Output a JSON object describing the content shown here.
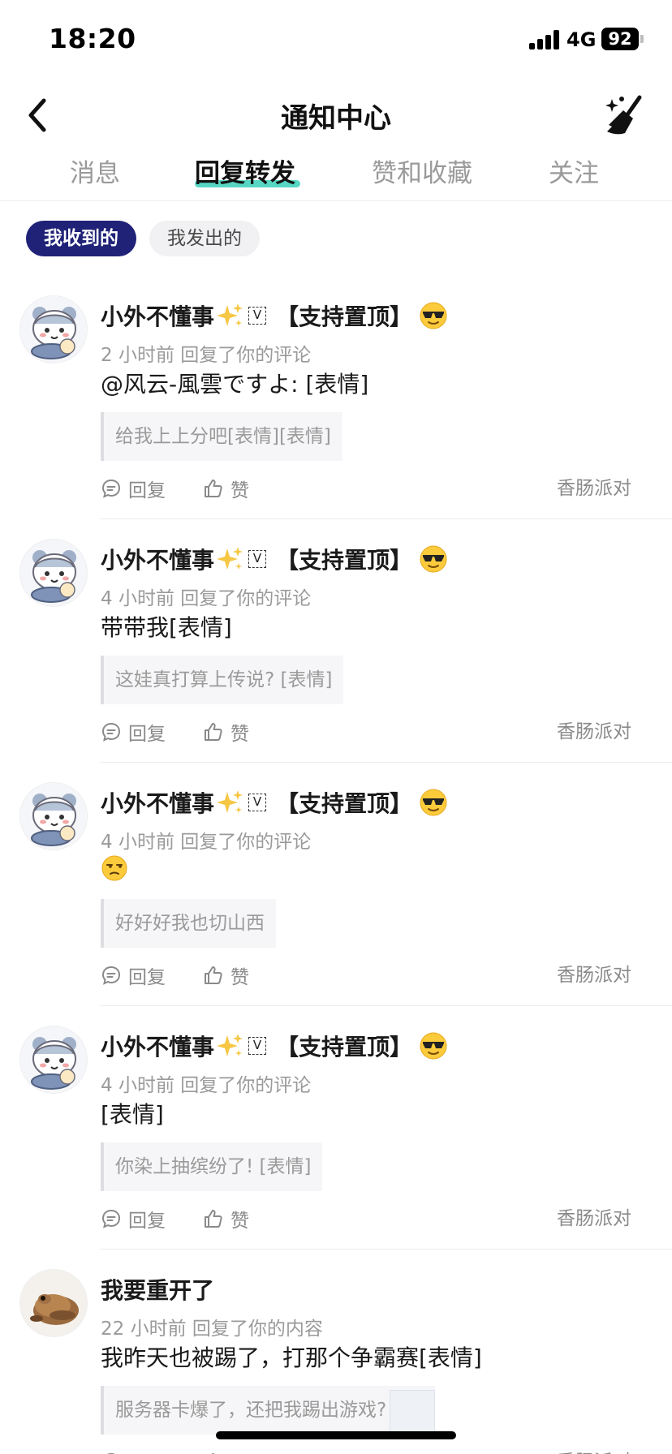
{
  "status_bar": {
    "time": "18:20",
    "network": "4G",
    "battery": "92"
  },
  "nav": {
    "title": "通知中心",
    "back_icon": "chevron-left-icon",
    "clear_icon": "broom-sparkle-icon"
  },
  "tabs": [
    {
      "label": "消息",
      "active": false
    },
    {
      "label": "回复转发",
      "active": true
    },
    {
      "label": "赞和收藏",
      "active": false
    },
    {
      "label": "关注",
      "active": false
    }
  ],
  "filters": {
    "received": "我收到的",
    "sent": "我发出的",
    "active": "received"
  },
  "colors": {
    "accent_navy": "#1f2277",
    "tab_underline": "#58d6c4",
    "muted_text": "#9a9a9a"
  },
  "actions": {
    "reply": "回复",
    "like": "赞"
  },
  "notifications": [
    {
      "user": "小外不懂事",
      "badge": "V",
      "tag": "【支持置顶】",
      "meta": "2 小时前 回复了你的评论",
      "content": "@风云-風雲ですよ: [表情]",
      "quote": "给我上上分吧[表情][表情]",
      "topic": "香肠派对",
      "avatar": "cartoon-avatar"
    },
    {
      "user": "小外不懂事",
      "badge": "V",
      "tag": "【支持置顶】",
      "meta": "4 小时前 回复了你的评论",
      "content": "带带我[表情]",
      "quote": "这娃真打算上传说? [表情]",
      "topic": "香肠派对",
      "avatar": "cartoon-avatar"
    },
    {
      "user": "小外不懂事",
      "badge": "V",
      "tag": "【支持置顶】",
      "meta": "4 小时前 回复了你的评论",
      "content": "",
      "content_emoji": "unamused-face-emoji",
      "quote": "好好好我也切山西",
      "topic": "香肠派对",
      "avatar": "cartoon-avatar"
    },
    {
      "user": "小外不懂事",
      "badge": "V",
      "tag": "【支持置顶】",
      "meta": "4 小时前 回复了你的评论",
      "content": "[表情]",
      "quote": "你染上抽缤纷了! [表情]",
      "topic": "香肠派对",
      "avatar": "cartoon-avatar"
    },
    {
      "user": "我要重开了",
      "meta": "22 小时前 回复了你的内容",
      "content": "我昨天也被踢了，打那个争霸赛[表情]",
      "quote": "服务器卡爆了，还把我踢出游戏?",
      "topic": "香肠派对",
      "avatar": "frog-photo-avatar"
    }
  ]
}
